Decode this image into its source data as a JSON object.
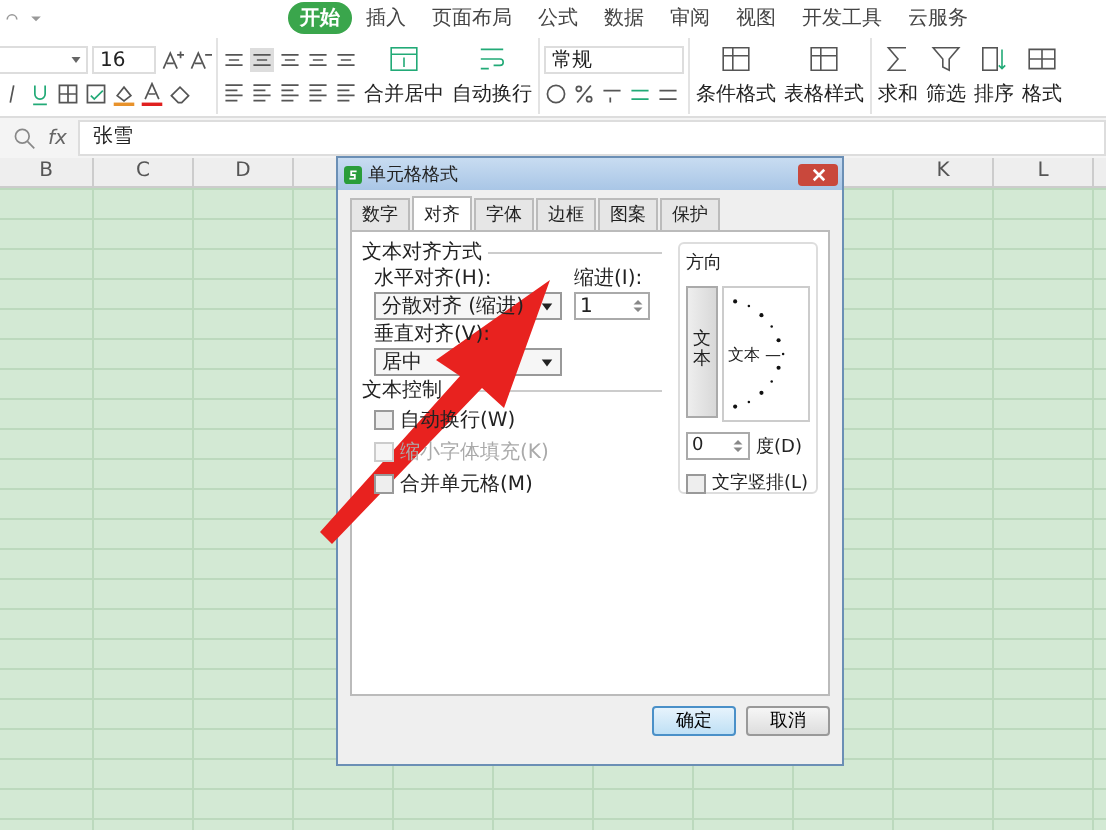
{
  "ribbon": {
    "tabs": [
      {
        "label": "开始",
        "selected": true
      },
      {
        "label": "插入",
        "selected": false
      },
      {
        "label": "页面布局",
        "selected": false
      },
      {
        "label": "公式",
        "selected": false
      },
      {
        "label": "数据",
        "selected": false
      },
      {
        "label": "审阅",
        "selected": false
      },
      {
        "label": "视图",
        "selected": false
      },
      {
        "label": "开发工具",
        "selected": false
      },
      {
        "label": "云服务",
        "selected": false
      }
    ],
    "font_size": "16",
    "merge_center": "合并居中",
    "wrap_text": "自动换行",
    "number_format": "常规",
    "conditional_format": "条件格式",
    "table_style": "表格样式",
    "sum": "求和",
    "filter": "筛选",
    "sort": "排序",
    "format": "格式"
  },
  "formula_bar": {
    "fx": "fx",
    "value": "张雪"
  },
  "column_headers": [
    "B",
    "C",
    "D",
    "K",
    "L"
  ],
  "dialog": {
    "title": "单元格格式",
    "tabs": [
      {
        "label": "数字",
        "selected": false
      },
      {
        "label": "对齐",
        "selected": true
      },
      {
        "label": "字体",
        "selected": false
      },
      {
        "label": "边框",
        "selected": false
      },
      {
        "label": "图案",
        "selected": false
      },
      {
        "label": "保护",
        "selected": false
      }
    ],
    "alignment_group": "文本对齐方式",
    "horizontal_label": "水平对齐(H):",
    "horizontal_value": "分散对齐 (缩进)",
    "indent_label": "缩进(I):",
    "indent_value": "1",
    "vertical_label": "垂直对齐(V):",
    "vertical_value": "居中",
    "control_group": "文本控制",
    "checkboxes": [
      {
        "label": "自动换行(W)",
        "checked": false,
        "disabled": false
      },
      {
        "label": "缩小字体填充(K)",
        "checked": false,
        "disabled": true
      },
      {
        "label": "合并单元格(M)",
        "checked": false,
        "disabled": false
      }
    ],
    "orientation_group": "方向",
    "vertical_text": "文本",
    "dial_text": "文本 —",
    "degrees_value": "0",
    "degrees_label": "度(D)",
    "stacked_text": {
      "label": "文字竖排(L)",
      "checked": false
    },
    "buttons": [
      "确定",
      "取消"
    ]
  }
}
